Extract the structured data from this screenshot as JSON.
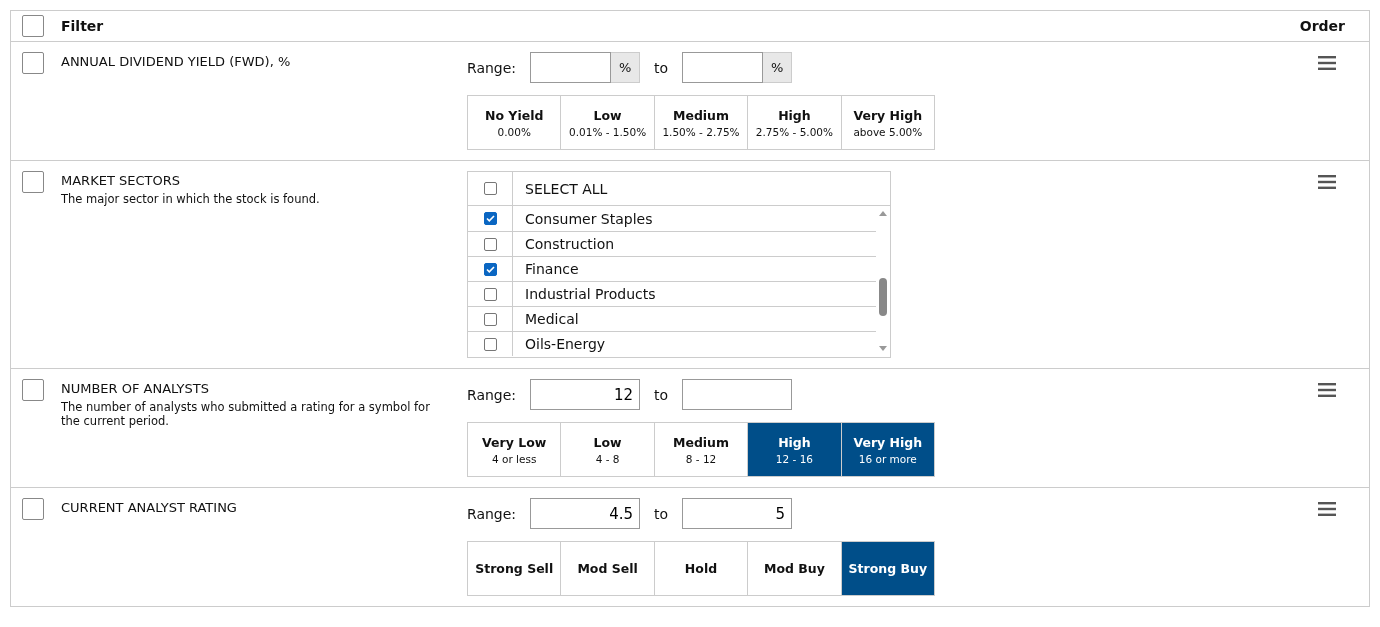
{
  "header": {
    "checked": false,
    "filter_label": "Filter",
    "order_label": "Order"
  },
  "filters": [
    {
      "kind": "range",
      "checked": false,
      "title": "ANNUAL DIVIDEND YIELD (FWD), %",
      "range_label": "Range:",
      "from": {
        "suffix": "%"
      },
      "to_label": "to",
      "to": {
        "suffix": "%"
      },
      "buckets": [
        {
          "label": "No Yield",
          "sub": "0.00%",
          "selected": false
        },
        {
          "label": "Low",
          "sub": "0.01% - 1.50%",
          "selected": false
        },
        {
          "label": "Medium",
          "sub": "1.50% - 2.75%",
          "selected": false
        },
        {
          "label": "High",
          "sub": "2.75% - 5.00%",
          "selected": false
        },
        {
          "label": "Very High",
          "sub": "above 5.00%",
          "selected": false
        }
      ]
    },
    {
      "kind": "checklist",
      "checked": false,
      "title": "MARKET SECTORS",
      "description": "The major sector in which the stock is found.",
      "select_all": {
        "label": "SELECT ALL",
        "checked": false
      },
      "items": [
        {
          "label": "Consumer Staples",
          "checked": true
        },
        {
          "label": "Construction",
          "checked": false
        },
        {
          "label": "Finance",
          "checked": true
        },
        {
          "label": "Industrial Products",
          "checked": false
        },
        {
          "label": "Medical",
          "checked": false
        },
        {
          "label": "Oils-Energy",
          "checked": false
        }
      ]
    },
    {
      "kind": "range",
      "checked": false,
      "title": "NUMBER OF ANALYSTS",
      "description": "The number of analysts who submitted a rating for a symbol for the current period.",
      "range_label": "Range:",
      "from": {
        "value": "12"
      },
      "to_label": "to",
      "buckets": [
        {
          "label": "Very Low",
          "sub": "4 or less",
          "selected": false
        },
        {
          "label": "Low",
          "sub": "4 - 8",
          "selected": false
        },
        {
          "label": "Medium",
          "sub": "8 - 12",
          "selected": false
        },
        {
          "label": "High",
          "sub": "12 - 16",
          "selected": true
        },
        {
          "label": "Very High",
          "sub": "16 or more",
          "selected": true
        }
      ]
    },
    {
      "kind": "range",
      "checked": false,
      "title": "CURRENT ANALYST RATING",
      "range_label": "Range:",
      "from": {
        "value": "4.5"
      },
      "to_label": "to",
      "to": {
        "value": "5"
      },
      "buckets": [
        {
          "label": "Strong Sell",
          "selected": false
        },
        {
          "label": "Mod Sell",
          "selected": false
        },
        {
          "label": "Hold",
          "selected": false
        },
        {
          "label": "Mod Buy",
          "selected": false
        },
        {
          "label": "Strong Buy",
          "selected": true
        }
      ]
    }
  ]
}
